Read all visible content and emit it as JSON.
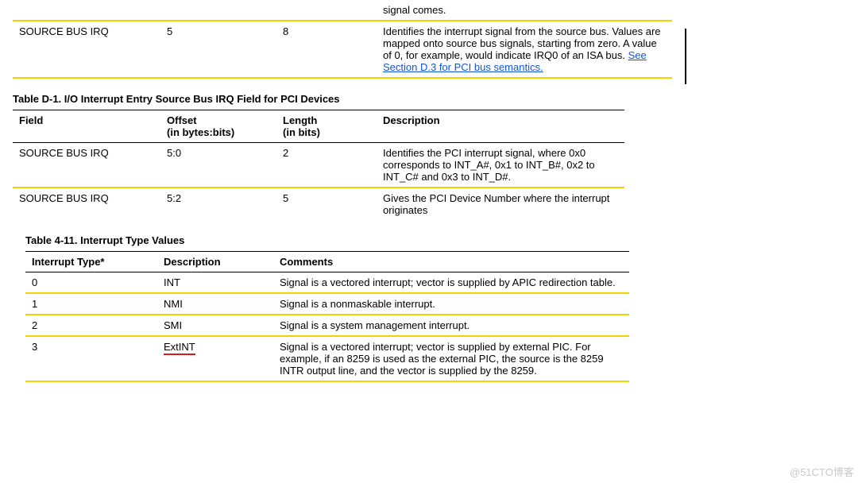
{
  "topFragment": {
    "cutoff": "signal comes.",
    "row": {
      "field": "SOURCE BUS IRQ",
      "offset": "5",
      "length": "8",
      "desc_part1": "Identifies the interrupt signal from the source bus.  Values are mapped onto source bus signals, starting from zero.  A value of 0, for example, would indicate IRQ0 of an ISA bus.",
      "link": "  See Section D.3 for PCI bus semantics."
    }
  },
  "tableD1": {
    "caption": "Table D-1.  I/O Interrupt Entry Source Bus IRQ Field for PCI Devices",
    "headers": {
      "field": "Field",
      "offset": "Offset\n(in bytes:bits)",
      "length": "Length\n(in bits)",
      "desc": "Description"
    },
    "rows": [
      {
        "field": "SOURCE BUS IRQ",
        "offset": "5:0",
        "length": "2",
        "desc": "Identifies the PCI interrupt signal, where 0x0 corresponds to INT_A#, 0x1 to INT_B#, 0x2 to INT_C# and 0x3 to INT_D#."
      },
      {
        "field": "SOURCE BUS IRQ",
        "offset": "5:2",
        "length": "5",
        "desc": "Gives the PCI Device Number where the interrupt originates"
      }
    ]
  },
  "table411": {
    "caption": "Table 4-11.  Interrupt Type Values",
    "headers": {
      "a": "Interrupt Type*",
      "b": "Description",
      "c": "Comments"
    },
    "rows": [
      {
        "a": "0",
        "b": "INT",
        "c": "Signal is a vectored interrupt; vector is supplied by APIC redirection table."
      },
      {
        "a": "1",
        "b": "NMI",
        "c": "Signal is a nonmaskable interrupt."
      },
      {
        "a": "2",
        "b": "SMI",
        "c": "Signal is a system management interrupt."
      },
      {
        "a": "3",
        "b": "ExtINT",
        "c": "Signal is a vectored interrupt; vector is supplied by external PIC.  For example, if an 8259 is used as the external PIC, the source is the 8259 INTR output line, and the vector is supplied by the 8259."
      }
    ]
  },
  "watermark": "@51CTO博客"
}
